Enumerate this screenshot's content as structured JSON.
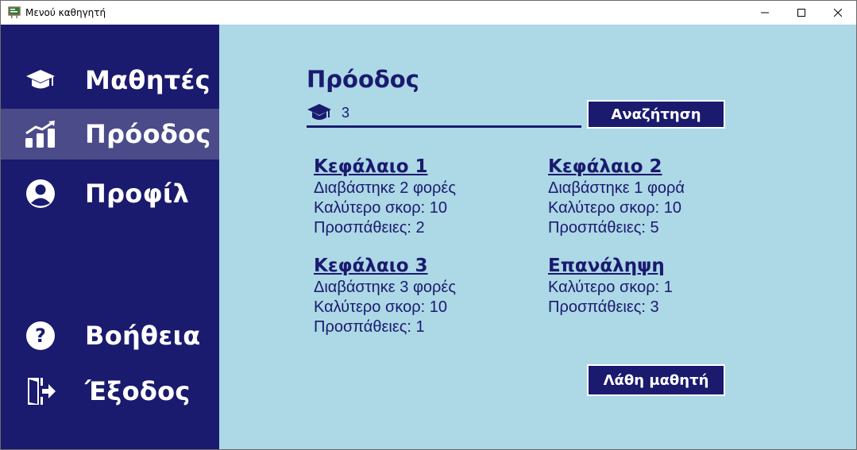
{
  "window": {
    "title": "Μενού καθηγητή"
  },
  "sidebar": {
    "items": [
      {
        "label": "Μαθητές",
        "icon": "graduation-cap-icon"
      },
      {
        "label": "Πρόοδος",
        "icon": "chart-bars-icon",
        "active": true
      },
      {
        "label": "Προφίλ",
        "icon": "user-circle-icon"
      },
      {
        "label": "Βοήθεια",
        "icon": "question-circle-icon"
      },
      {
        "label": "Έξοδος",
        "icon": "exit-door-icon"
      }
    ]
  },
  "main": {
    "title": "Πρόοδος",
    "search": {
      "value": "3",
      "button_label": "Αναζήτηση"
    },
    "chapters": [
      {
        "title": "Κεφάλαιο 1",
        "lines": [
          "Διαβάστηκε 2 φορές",
          "Καλύτερο σκορ: 10",
          "Προσπάθειες: 2"
        ]
      },
      {
        "title": "Κεφάλαιο 2",
        "lines": [
          "Διαβάστηκε 1 φορά",
          "Καλύτερο σκορ: 10",
          "Προσπάθειες: 5"
        ]
      },
      {
        "title": "Κεφάλαιο 3",
        "lines": [
          "Διαβάστηκε 3 φορές",
          "Καλύτερο σκορ: 10",
          "Προσπάθειες: 1"
        ]
      },
      {
        "title": "Επανάληψη",
        "lines": [
          "Καλύτερο σκορ: 1",
          "Προσπάθειες: 3"
        ]
      }
    ],
    "mistakes_button_label": "Λάθη μαθητή"
  },
  "colors": {
    "sidebar": "#1a1a6e",
    "sidebar_active": "#4b4b8a",
    "main_bg": "#add8e6",
    "accent": "#1a1a6e"
  }
}
